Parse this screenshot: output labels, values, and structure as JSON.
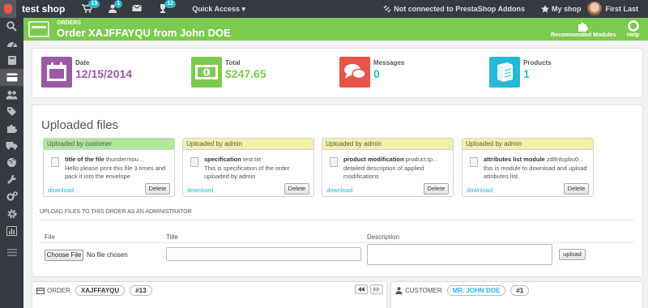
{
  "topbar": {
    "shop_name": "test shop",
    "notifications": {
      "orders": "13",
      "customers": "1",
      "messages": "",
      "trophies": "12"
    },
    "quick_access": "Quick Access",
    "addons_status": "Not connected to PrestaShop Addons",
    "my_shop": "My shop",
    "user_name": "First Last"
  },
  "header": {
    "breadcrumb": "ORDERS",
    "title": "Order XAJFFAYQU from John DOE",
    "recommended_modules": "Recommended Modules",
    "help": "Help"
  },
  "kpis": [
    {
      "label": "Date",
      "value": "12/15/2014",
      "color": "#9b59a6"
    },
    {
      "label": "Total",
      "value": "$247.65",
      "color": "#7dca50"
    },
    {
      "label": "Messages",
      "value": "0",
      "color": "#e8534a"
    },
    {
      "label": "Products",
      "value": "1",
      "color": "#25b9d7"
    }
  ],
  "uploaded": {
    "title": "Uploaded files",
    "cards": [
      {
        "uploader": "Uploaded by customer",
        "name_bold": "title of the file",
        "name_rest": " thundermou...",
        "desc": "Hello please print this file 3 times and pack it into the envelope",
        "download": "download",
        "delete": "Delete"
      },
      {
        "uploader": "Uploaded by admin",
        "name_bold": "specification",
        "name_rest": " test.txt",
        "desc": "This is specification of the order uploaded by admin",
        "download": "download",
        "delete": "Delete"
      },
      {
        "uploader": "Uploaded by admin",
        "name_bold": "product modification",
        "name_rest": " product.tp...",
        "desc": "detailed description of applied modifications",
        "download": "download",
        "delete": "Delete"
      },
      {
        "uploader": "Uploaded by admin",
        "name_bold": "attributes list module",
        "name_rest": " zd8ntupbu0...",
        "desc": "this is module to download and upload attributes list",
        "download": "download",
        "delete": "Delete"
      }
    ],
    "admin_section": "UPLOAD FILES TO THIS ORDER AS AN ADMINISTRATOR",
    "columns": {
      "file": "File",
      "title": "Title",
      "description": "Description"
    },
    "choose_file": "Choose File",
    "no_file": "No file chosen",
    "upload": "upload"
  },
  "order_panel": {
    "label": "ORDER",
    "reference": "XAJFFAYQU",
    "id": "#13"
  },
  "customer_panel": {
    "label": "CUSTOMER",
    "name": "MR. JOHN DOE",
    "id": "#1"
  }
}
